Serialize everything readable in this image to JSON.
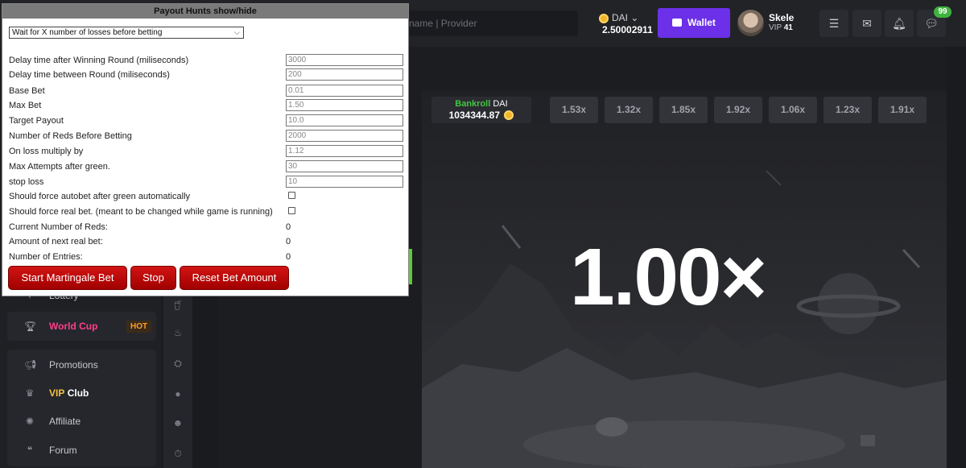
{
  "header": {
    "search_placeholder": "name | Provider",
    "balance": {
      "currency": "DAI",
      "amount": "2.50002911"
    },
    "wallet_label": "Wallet",
    "user": {
      "name": "Skele",
      "vip_prefix": "VIP",
      "vip_level": "41"
    },
    "notification_count": "99"
  },
  "sidebar": {
    "lottery_label": "Lottery",
    "worldcup_label": "World Cup",
    "hot_label": "HOT",
    "items": [
      {
        "label": "Promotions"
      },
      {
        "label_vip": "VIP",
        "label_club": "Club"
      },
      {
        "label": "Affiliate"
      },
      {
        "label": "Forum"
      }
    ]
  },
  "game": {
    "bankroll_label": "Bankroll",
    "bankroll_currency": "DAI",
    "bankroll_value": "1034344.87",
    "history": [
      "1.53x",
      "1.32x",
      "1.85x",
      "1.92x",
      "1.06x",
      "1.23x",
      "1.91x"
    ],
    "multiplier": "1.00×"
  },
  "panel": {
    "title": "Payout Hunts show/hide",
    "mode_selected": "Wait for X number of losses before betting",
    "fields": [
      {
        "label": "Delay time after Winning Round (miliseconds)",
        "value": "3000"
      },
      {
        "label": "Delay time between Round (miliseconds)",
        "value": "200"
      },
      {
        "label": "Base Bet",
        "value": "0.01"
      },
      {
        "label": "Max Bet",
        "value": "1.50"
      },
      {
        "label": "Target Payout",
        "value": "10.0"
      },
      {
        "label": "Number of Reds Before Betting",
        "value": "2000"
      },
      {
        "label": "On loss multiply by",
        "value": "1.12"
      },
      {
        "label": "Max Attempts after green.",
        "value": "30"
      },
      {
        "label": "stop loss",
        "value": "10"
      }
    ],
    "checks": [
      {
        "label": "Should force autobet after green automatically",
        "checked": false
      },
      {
        "label": "Should force real bet. (meant to be changed while game is running)",
        "checked": false
      }
    ],
    "stats": [
      {
        "label": "Current Number of Reds:",
        "value": "0"
      },
      {
        "label": "Amount of next real bet:",
        "value": "0"
      },
      {
        "label": "Number of Entries:",
        "value": "0"
      }
    ],
    "buttons": {
      "start": "Start Martingale Bet",
      "stop": "Stop",
      "reset": "Reset Bet Amount"
    }
  }
}
